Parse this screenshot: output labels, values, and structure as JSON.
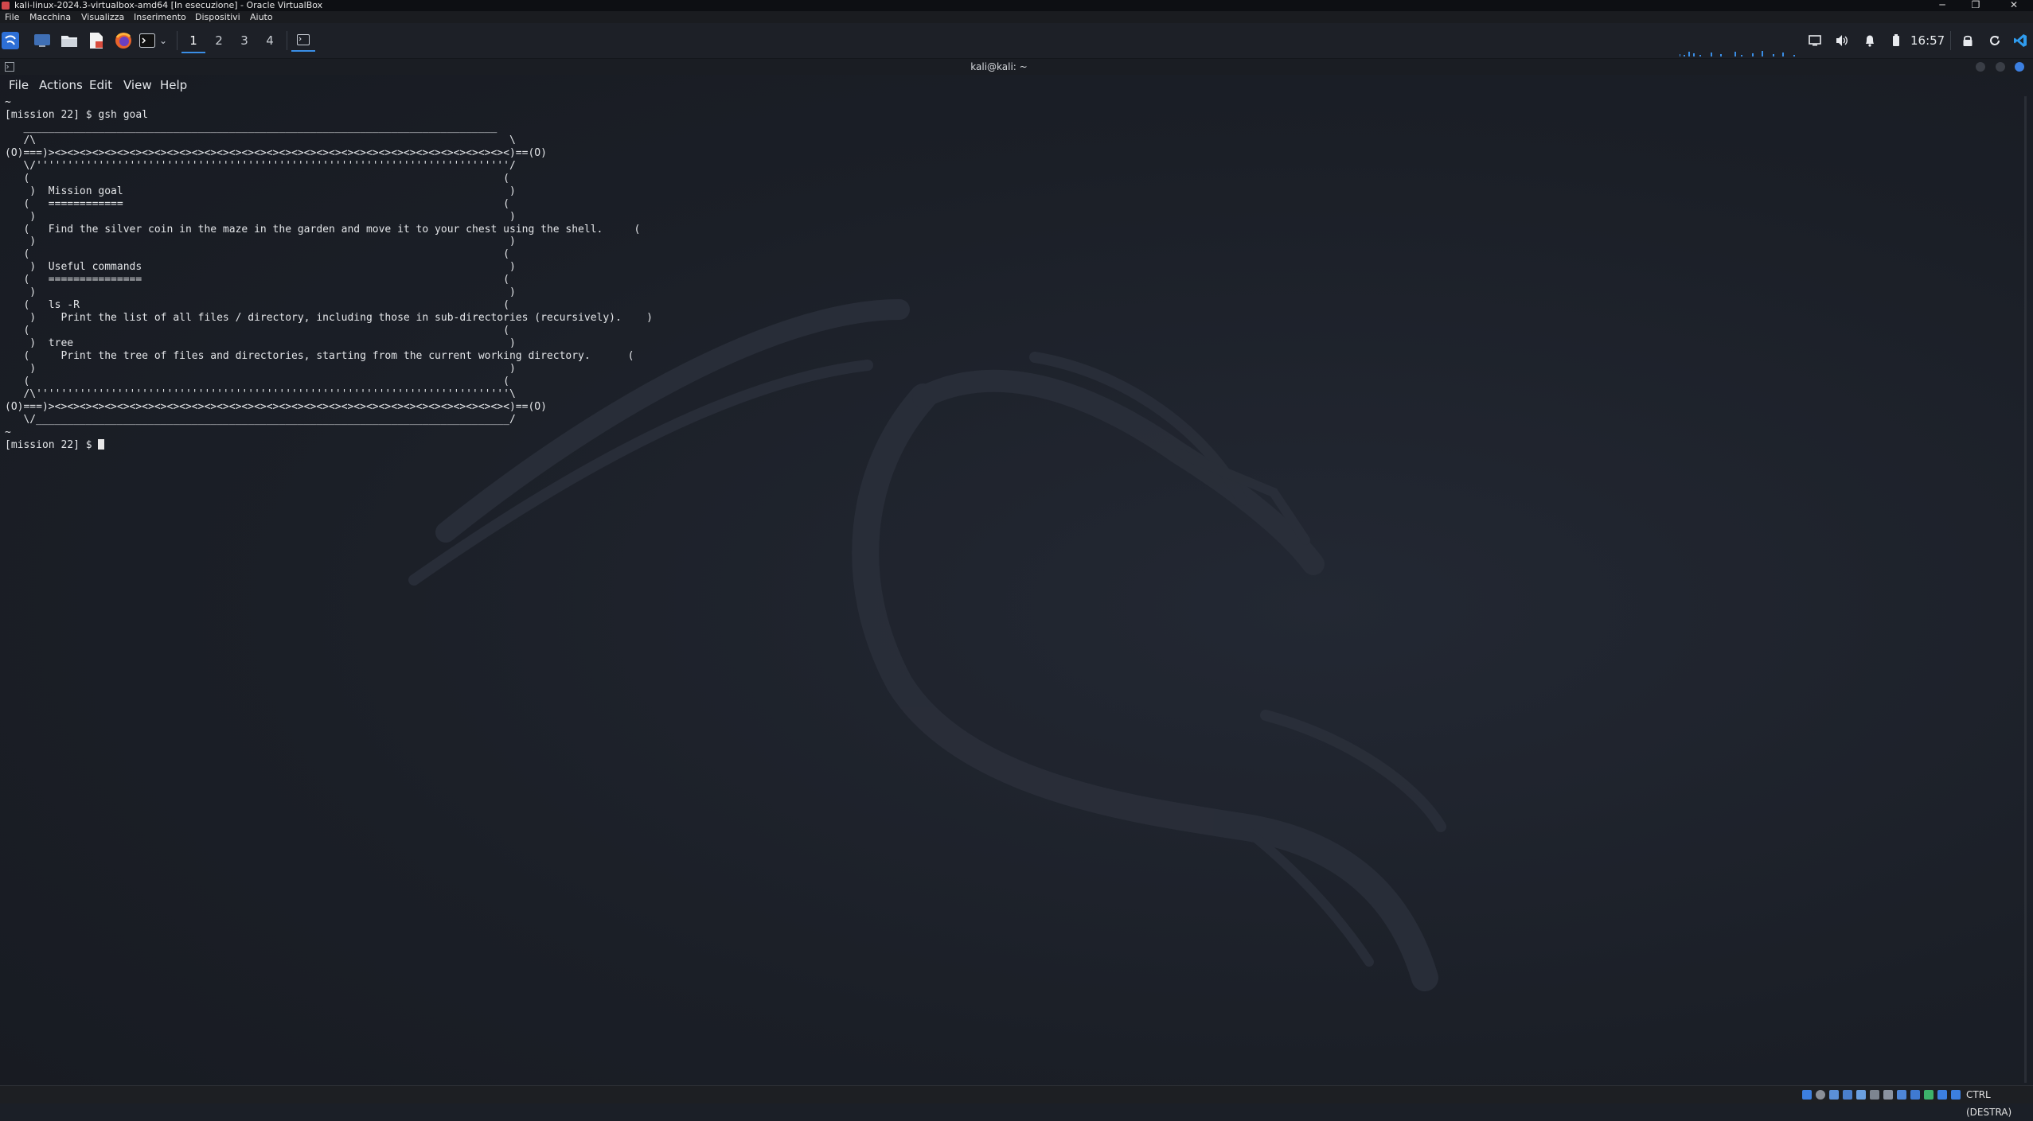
{
  "host_window": {
    "title": "kali-linux-2024.3-virtualbox-amd64 [In esecuzione] - Oracle VirtualBox",
    "controls": [
      "─",
      "❐",
      "✕"
    ]
  },
  "host_menu": [
    "File",
    "Macchina",
    "Visualizza",
    "Inserimento",
    "Dispositivi",
    "Aiuto"
  ],
  "panel": {
    "workspaces": [
      "1",
      "2",
      "3",
      "4"
    ],
    "active_workspace": "1",
    "clock": "16:57"
  },
  "terminal": {
    "title": "kali@kali: ~",
    "menu": [
      "File",
      "Actions",
      "Edit",
      "View",
      "Help"
    ],
    "lines": [
      "~",
      "[mission 22] $ gsh goal",
      "",
      "   ____________________________________________________________________________",
      "   /\\                                                                            \\",
      "(O)===)><><><><><><><><><><><><><><><><><><><><><><><><><><><><><><><><><><><><><)==(O)",
      "   \\/''''''''''''''''''''''''''''''''''''''''''''''''''''''''''''''''''''''''''''/",
      "   (                                                                            (",
      "    )  Mission goal                                                              )",
      "   (   ============                                                             (",
      "    )                                                                            )",
      "   (   Find the silver coin in the maze in the garden and move it to your chest using the shell.     (",
      "    )                                                                            )",
      "   (                                                                            (",
      "    )  Useful commands                                                           )",
      "   (   ===============                                                          (",
      "    )                                                                            )",
      "   (   ls -R                                                                    (",
      "    )    Print the list of all files / directory, including those in sub-directories (recursively).    )",
      "   (                                                                            (",
      "    )  tree                                                                      )",
      "   (     Print the tree of files and directories, starting from the current working directory.      (",
      "    )                                                                            )",
      "   (                                                                            (",
      "   /\\''''''''''''''''''''''''''''''''''''''''''''''''''''''''''''''''''''''''''''\\",
      "(O)===)><><><><><><><><><><><><><><><><><><><><><><><><><><><><><><><><><><><><><)==(O)",
      "   \\/____________________________________________________________________________/",
      "",
      "",
      "~",
      "[mission 22] $ "
    ]
  },
  "host_status": {
    "host_key": "CTRL (DESTRA)"
  },
  "colors": {
    "accent": "#3a8ee6",
    "background": "#1b1f27",
    "panel": "#1d2027",
    "text": "#e3e5e8"
  },
  "icons": {
    "panel": [
      "kali-menu-icon",
      "desktop-icon",
      "file-manager-icon",
      "text-editor-icon",
      "firefox-icon",
      "terminal-icon",
      "window-switcher-icon"
    ],
    "tray": [
      "display-icon",
      "volume-icon",
      "notification-bell-icon",
      "battery-icon",
      "lock-icon",
      "refresh-icon",
      "vscode-icon"
    ],
    "status": [
      "hard-disk-icon",
      "optical-drive-icon",
      "audio-icon",
      "network-icon",
      "usb-icon",
      "shared-folder-icon",
      "display-icon",
      "recording-icon",
      "cpu-icon",
      "mouse-integration-icon"
    ]
  }
}
